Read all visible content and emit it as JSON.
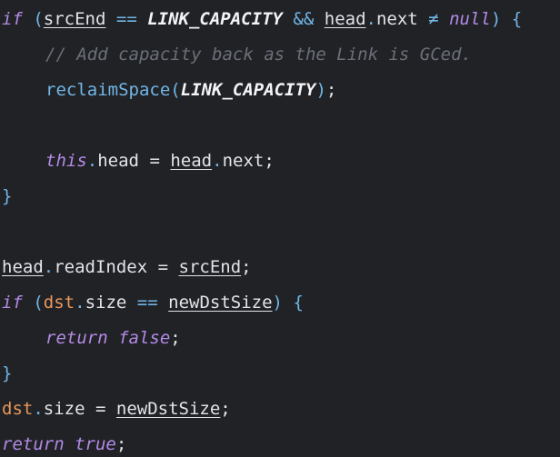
{
  "editor": {
    "lines": {
      "l1": {
        "if": "if",
        "lp": "(",
        "srcEnd": "srcEnd",
        "eq": "==",
        "cap": "LINK_CAPACITY",
        "and": "&&",
        "head": "head",
        "dot": ".",
        "next": "next",
        "ne": "≠",
        "null": "null",
        "rp": ")",
        "lb": "{"
      },
      "l2": {
        "comment": "// Add capacity back as the Link is GCed."
      },
      "l3": {
        "fn": "reclaimSpace",
        "lp": "(",
        "cap": "LINK_CAPACITY",
        "rp": ")",
        "semi": ";"
      },
      "l5": {
        "this": "this",
        "dot1": ".",
        "head": "head",
        "eq": "=",
        "head2": "head",
        "dot2": ".",
        "next": "next",
        "semi": ";"
      },
      "l6": {
        "rb": "}"
      },
      "l8": {
        "head": "head",
        "dot": ".",
        "readIndex": "readIndex",
        "eq": "=",
        "srcEnd": "srcEnd",
        "semi": ";"
      },
      "l9": {
        "if": "if",
        "lp": "(",
        "dst": "dst",
        "dot": ".",
        "size": "size",
        "eq": "==",
        "newDstSize": "newDstSize",
        "rp": ")",
        "lb": "{"
      },
      "l10": {
        "return": "return",
        "false": "false",
        "semi": ";"
      },
      "l11": {
        "rb": "}"
      },
      "l12": {
        "dst": "dst",
        "dot": ".",
        "size": "size",
        "eq": "=",
        "newDstSize": "newDstSize",
        "semi": ";"
      },
      "l13": {
        "return": "return",
        "true": "true",
        "semi": ";"
      }
    }
  }
}
